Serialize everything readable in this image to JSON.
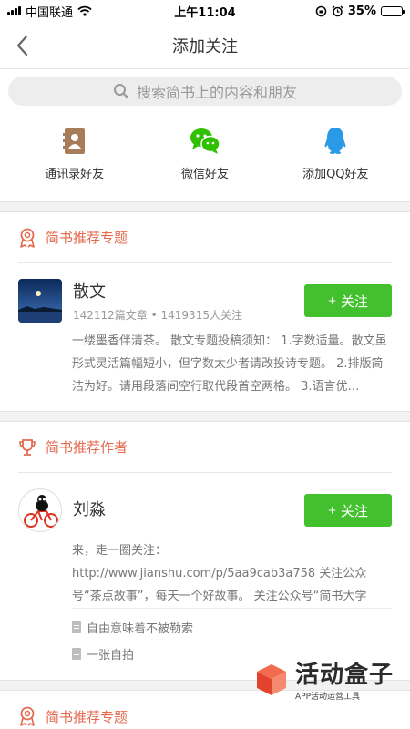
{
  "status_bar": {
    "carrier": "中国联通",
    "time": "上午11:04",
    "battery": "35%",
    "battery_level": 0.35
  },
  "nav": {
    "title": "添加关注"
  },
  "search": {
    "placeholder": "搜索简书上的内容和朋友"
  },
  "friends": [
    {
      "label": "通讯录好友",
      "icon": "contacts-book-icon"
    },
    {
      "label": "微信好友",
      "icon": "wechat-icon"
    },
    {
      "label": "添加QQ好友",
      "icon": "qq-icon"
    }
  ],
  "recommended_topic": {
    "header": "简书推荐专题",
    "name": "散文",
    "meta": "142112篇文章 • 1419315人关注",
    "follow_label": "关注",
    "description": "一缕墨香伴清茶。    散文专题投稿须知：  1.字数适量。散文虽形式灵活篇幅短小，但字数太少者请改投诗专题。  2.排版简洁为好。请用段落间空行取代段首空两格。  3.语言优…"
  },
  "recommended_author": {
    "header": "简书推荐作者",
    "name": "刘淼",
    "follow_label": "关注",
    "description": "来，走一圈关注： http://www.jianshu.com/p/5aa9cab3a758  关注公众号“茶点故事”，每天一个好故事。  关注公众号“简书大学堂”，周周有福利。  简书每天…",
    "articles": [
      "自由意味着不被勒索",
      "一张自拍"
    ]
  },
  "recommended_topic_2": {
    "header": "简书推荐专题"
  },
  "watermark": {
    "brand": "活动盒子",
    "tagline": "APP活动运营工具"
  },
  "colors": {
    "accent": "#e46a4e",
    "follow_green": "#42c02e",
    "wechat_green": "#2dc100",
    "qq_blue": "#2a9ae6"
  }
}
